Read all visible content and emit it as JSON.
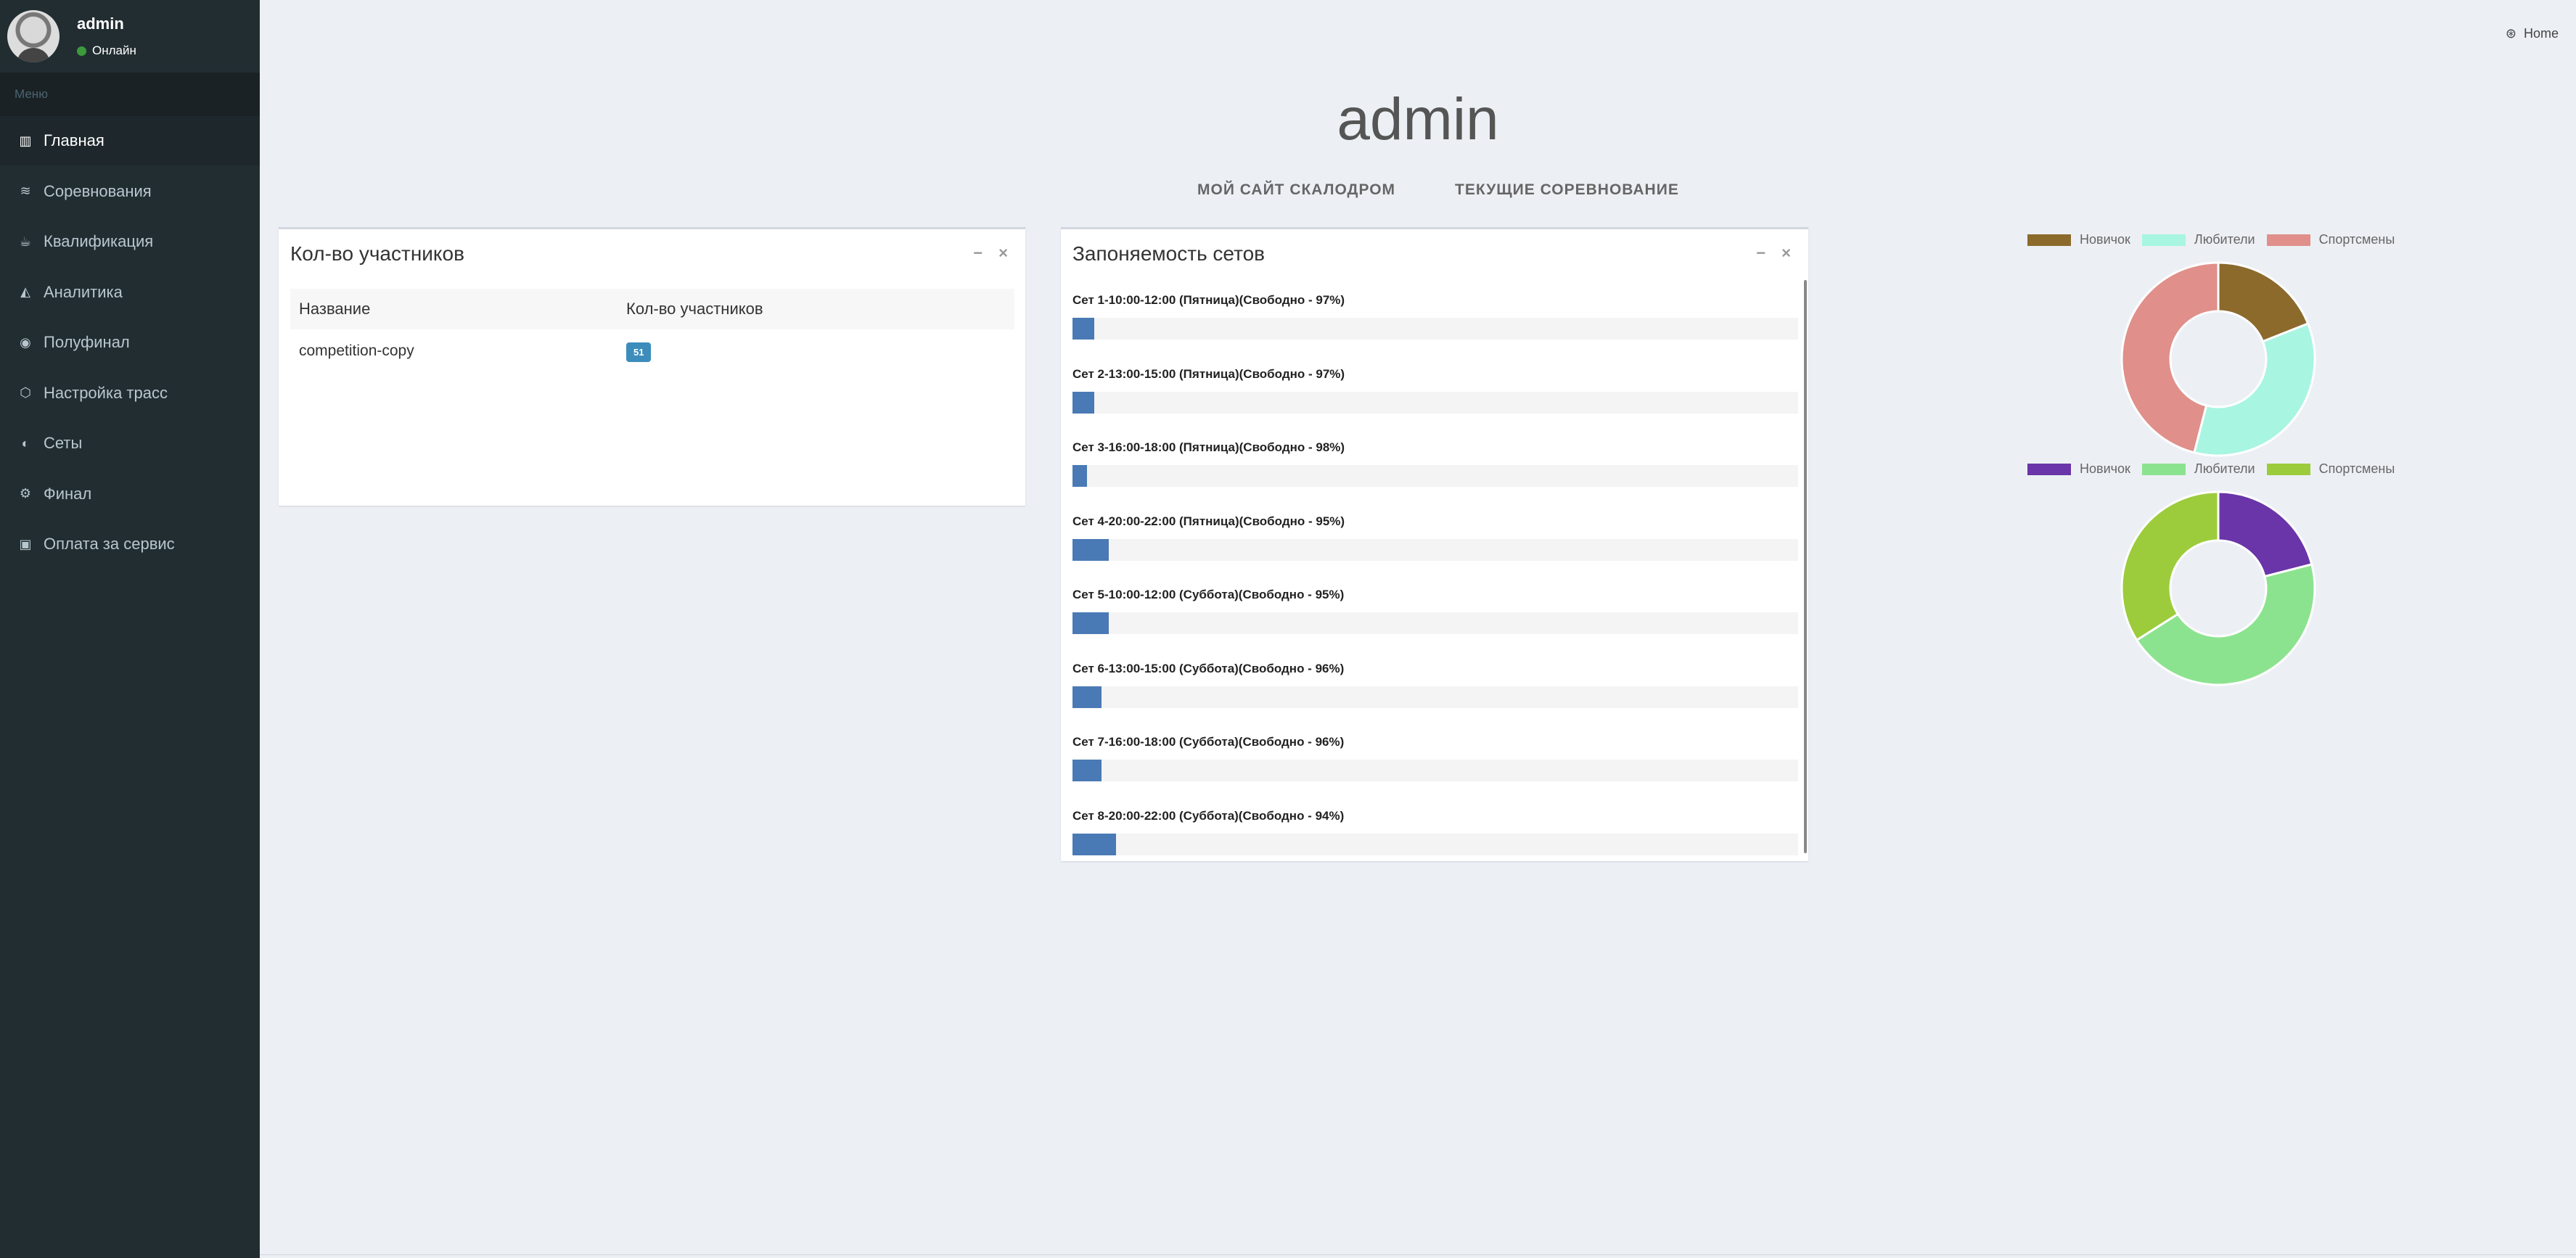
{
  "user": {
    "name": "admin",
    "status": "Онлайн"
  },
  "menu": {
    "header": "Меню",
    "items": [
      {
        "label": "Главная",
        "icon": "bar-chart-icon",
        "active": true
      },
      {
        "label": "Соревнования",
        "icon": "rss-icon"
      },
      {
        "label": "Квалификация",
        "icon": "coffee-cup-icon"
      },
      {
        "label": "Аналитика",
        "icon": "area-chart-icon"
      },
      {
        "label": "Полуфинал",
        "icon": "compass-icon"
      },
      {
        "label": "Настройка трасс",
        "icon": "cube-icon"
      },
      {
        "label": "Сеты",
        "icon": "half-circle-icon"
      },
      {
        "label": "Финал",
        "icon": "gears-icon"
      },
      {
        "label": "Оплата за сервис",
        "icon": "money-icon"
      }
    ]
  },
  "header": {
    "home": "Home",
    "title": "admin"
  },
  "nav": {
    "site": "МОЙ САЙТ СКАЛОДРОМ",
    "current": "ТЕКУЩИЕ СОРЕВНОВАНИЕ"
  },
  "participants": {
    "title": "Кол-во участников",
    "columns": [
      "Название",
      "Кол-во участников"
    ],
    "rows": [
      {
        "name": "competition-copy",
        "count": "51"
      }
    ]
  },
  "sets": {
    "title": "Запоняемость сетов",
    "items": [
      {
        "label": "Сет 1-10:00-12:00 (Пятница)(Свободно - 97%)",
        "filled": 3
      },
      {
        "label": "Сет 2-13:00-15:00 (Пятница)(Свободно - 97%)",
        "filled": 3
      },
      {
        "label": "Сет 3-16:00-18:00 (Пятница)(Свободно - 98%)",
        "filled": 2
      },
      {
        "label": "Сет 4-20:00-22:00 (Пятница)(Свободно - 95%)",
        "filled": 5
      },
      {
        "label": "Сет 5-10:00-12:00 (Суббота)(Свободно - 95%)",
        "filled": 5
      },
      {
        "label": "Сет 6-13:00-15:00 (Суббота)(Свободно - 96%)",
        "filled": 4
      },
      {
        "label": "Сет 7-16:00-18:00 (Суббота)(Свободно - 96%)",
        "filled": 4
      },
      {
        "label": "Сет 8-20:00-22:00 (Суббота)(Свободно - 94%)",
        "filled": 6
      }
    ]
  },
  "chart_data": [
    {
      "type": "pie",
      "categories": [
        "Новичок",
        "Любители",
        "Спортсмены"
      ],
      "values": [
        19,
        35,
        46
      ],
      "colors": [
        "#8b6a2c",
        "#a8f5e2",
        "#e08f8a"
      ],
      "legend": "top"
    },
    {
      "type": "pie",
      "categories": [
        "Новичок",
        "Любители",
        "Спортсмены"
      ],
      "values": [
        21,
        45,
        34
      ],
      "colors": [
        "#6a35a8",
        "#8ce38f",
        "#9ccc3c"
      ],
      "legend": "top"
    }
  ]
}
